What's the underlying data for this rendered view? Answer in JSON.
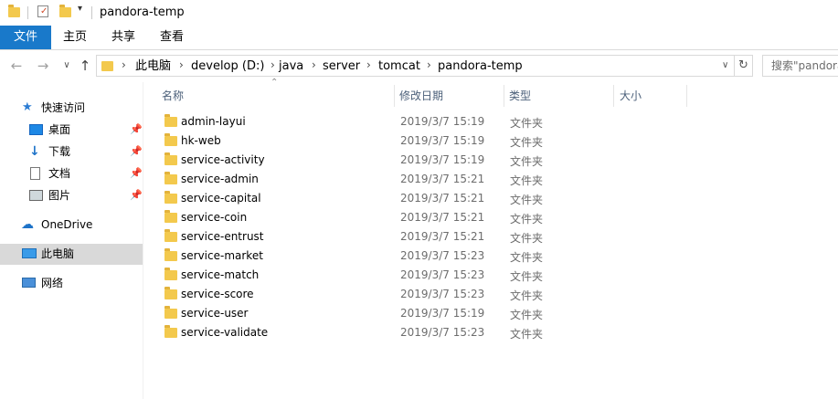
{
  "window": {
    "title": "pandora-temp"
  },
  "ribbon": {
    "tabs": [
      "文件",
      "主页",
      "共享",
      "查看"
    ]
  },
  "address": {
    "crumbs": [
      "此电脑",
      "develop (D:)",
      "java",
      "server",
      "tomcat",
      "pandora-temp"
    ],
    "search_placeholder": "搜索\"pandora-temp\""
  },
  "sidebar": {
    "quick_access": "快速访问",
    "quick_items": [
      "桌面",
      "下载",
      "文档",
      "图片"
    ],
    "onedrive": "OneDrive",
    "this_pc": "此电脑",
    "network": "网络"
  },
  "columns": {
    "name": "名称",
    "date": "修改日期",
    "type": "类型",
    "size": "大小"
  },
  "files": [
    {
      "name": "admin-layui",
      "date": "2019/3/7 15:19",
      "type": "文件夹"
    },
    {
      "name": "hk-web",
      "date": "2019/3/7 15:19",
      "type": "文件夹"
    },
    {
      "name": "service-activity",
      "date": "2019/3/7 15:19",
      "type": "文件夹"
    },
    {
      "name": "service-admin",
      "date": "2019/3/7 15:21",
      "type": "文件夹"
    },
    {
      "name": "service-capital",
      "date": "2019/3/7 15:21",
      "type": "文件夹"
    },
    {
      "name": "service-coin",
      "date": "2019/3/7 15:21",
      "type": "文件夹"
    },
    {
      "name": "service-entrust",
      "date": "2019/3/7 15:21",
      "type": "文件夹"
    },
    {
      "name": "service-market",
      "date": "2019/3/7 15:23",
      "type": "文件夹"
    },
    {
      "name": "service-match",
      "date": "2019/3/7 15:23",
      "type": "文件夹"
    },
    {
      "name": "service-score",
      "date": "2019/3/7 15:23",
      "type": "文件夹"
    },
    {
      "name": "service-user",
      "date": "2019/3/7 15:19",
      "type": "文件夹"
    },
    {
      "name": "service-validate",
      "date": "2019/3/7 15:23",
      "type": "文件夹"
    }
  ]
}
